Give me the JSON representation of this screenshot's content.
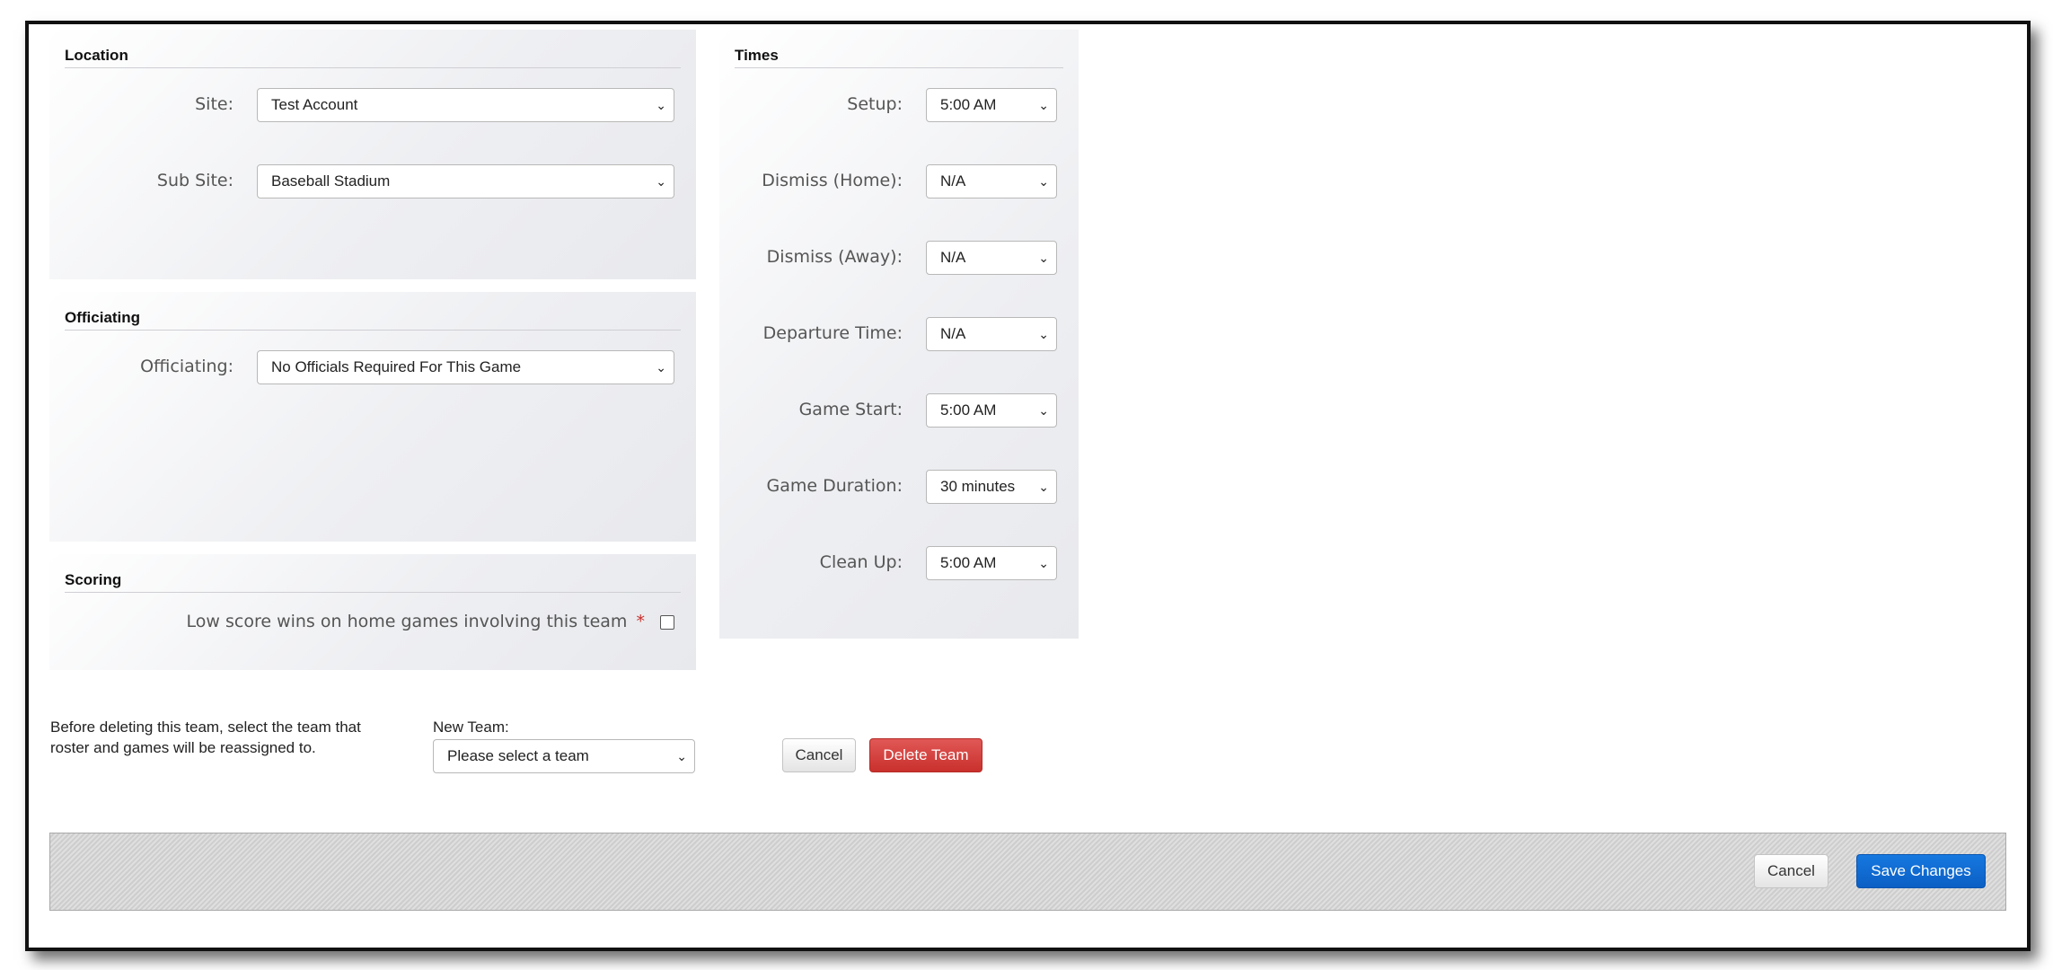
{
  "location": {
    "title": "Location",
    "site_label": "Site:",
    "site_value": "Test Account",
    "subsite_label": "Sub Site:",
    "subsite_value": "Baseball Stadium"
  },
  "officiating": {
    "title": "Officiating",
    "label": "Officiating:",
    "value": "No Officials Required For This Game"
  },
  "scoring": {
    "title": "Scoring",
    "low_score_label": "Low score wins on home games involving this team",
    "required_marker": "*",
    "low_score_checked": false
  },
  "times": {
    "title": "Times",
    "rows": [
      {
        "label": "Setup:",
        "value": "5:00 AM"
      },
      {
        "label": "Dismiss (Home):",
        "value": "N/A"
      },
      {
        "label": "Dismiss (Away):",
        "value": "N/A"
      },
      {
        "label": "Departure Time:",
        "value": "N/A"
      },
      {
        "label": "Game Start:",
        "value": "5:00 AM"
      },
      {
        "label": "Game Duration:",
        "value": "30 minutes"
      },
      {
        "label": "Clean Up:",
        "value": "5:00 AM"
      }
    ]
  },
  "delete_team": {
    "instruction_line1": "Before deleting this team, select the team that",
    "instruction_line2": "roster and games will be reassigned to.",
    "new_team_label": "New Team:",
    "new_team_value": "Please select a team",
    "cancel_label": "Cancel",
    "delete_label": "Delete Team"
  },
  "footer": {
    "cancel_label": "Cancel",
    "save_label": "Save Changes"
  },
  "colors": {
    "primary": "#0b5fc4",
    "danger": "#c9302c",
    "required": "#c9302c"
  }
}
